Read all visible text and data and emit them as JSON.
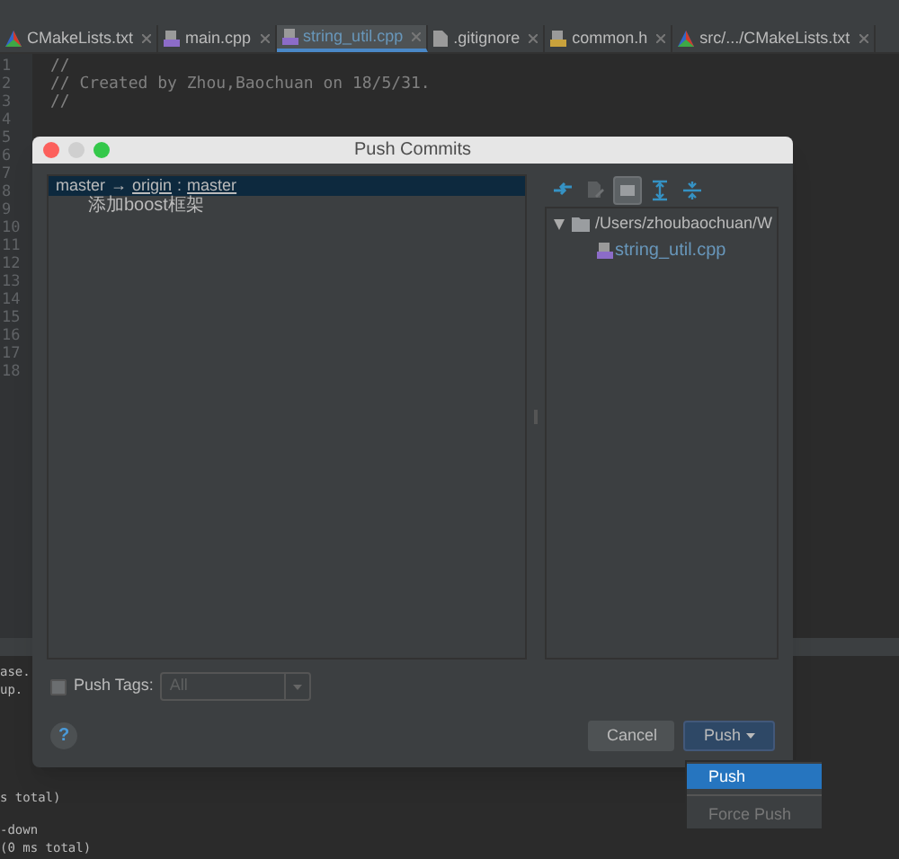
{
  "editor_tabs": [
    {
      "label": "CMakeLists.txt",
      "kind": "cmake",
      "selected": false
    },
    {
      "label": "main.cpp",
      "kind": "cpp",
      "selected": false
    },
    {
      "label": "string_util.cpp",
      "kind": "cpp",
      "selected": true
    },
    {
      "label": ".gitignore",
      "kind": "text",
      "selected": false
    },
    {
      "label": "common.h",
      "kind": "header",
      "selected": false
    },
    {
      "label": "src/.../CMakeLists.txt",
      "kind": "cmake",
      "selected": false
    }
  ],
  "editor": {
    "line_numbers": [
      "1",
      "2",
      "3",
      "4",
      "5",
      "6",
      "7",
      "8",
      "9",
      "10",
      "11",
      "12",
      "13",
      "14",
      "15",
      "16",
      "17",
      "18"
    ],
    "code_lines": [
      {
        "kind": "comment",
        "text": "//"
      },
      {
        "kind": "comment",
        "text": "// Created by Zhou,Baochuan on 18/5/31."
      },
      {
        "kind": "comment",
        "text": "//"
      }
    ]
  },
  "console": {
    "blocks": [
      [
        "ase.",
        "up."
      ],
      [
        "s total)"
      ],
      [
        "-down",
        "(0 ms total)"
      ]
    ]
  },
  "dialog": {
    "title": "Push Commits",
    "branch": {
      "source": "master",
      "arrow": "→",
      "remote": "origin",
      "separator": ":",
      "target": "master",
      "selected": true
    },
    "commits": [
      "添加boost框架"
    ],
    "toolbar": [
      {
        "kind": "arrows",
        "pressed": false
      },
      {
        "kind": "edit",
        "pressed": false
      },
      {
        "kind": "group",
        "pressed": true
      },
      {
        "kind": "expand",
        "pressed": false
      },
      {
        "kind": "collapse",
        "pressed": false
      }
    ],
    "tree": {
      "label": "/Users/zhoubaochuan/W",
      "expanded": true,
      "children": [
        {
          "label": "string_util.cpp"
        }
      ]
    },
    "push_tags": {
      "label": "Push Tags:",
      "checked": false,
      "select": {
        "value": "All",
        "disabled": true
      }
    },
    "help": "?",
    "buttons": [
      {
        "label": "Cancel",
        "kind": "normal"
      },
      {
        "label": "Push",
        "kind": "split"
      }
    ],
    "menu": [
      {
        "label": "Push",
        "selected": true,
        "disabled": false
      },
      {
        "label": "Force Push",
        "selected": false,
        "disabled": true
      }
    ]
  }
}
